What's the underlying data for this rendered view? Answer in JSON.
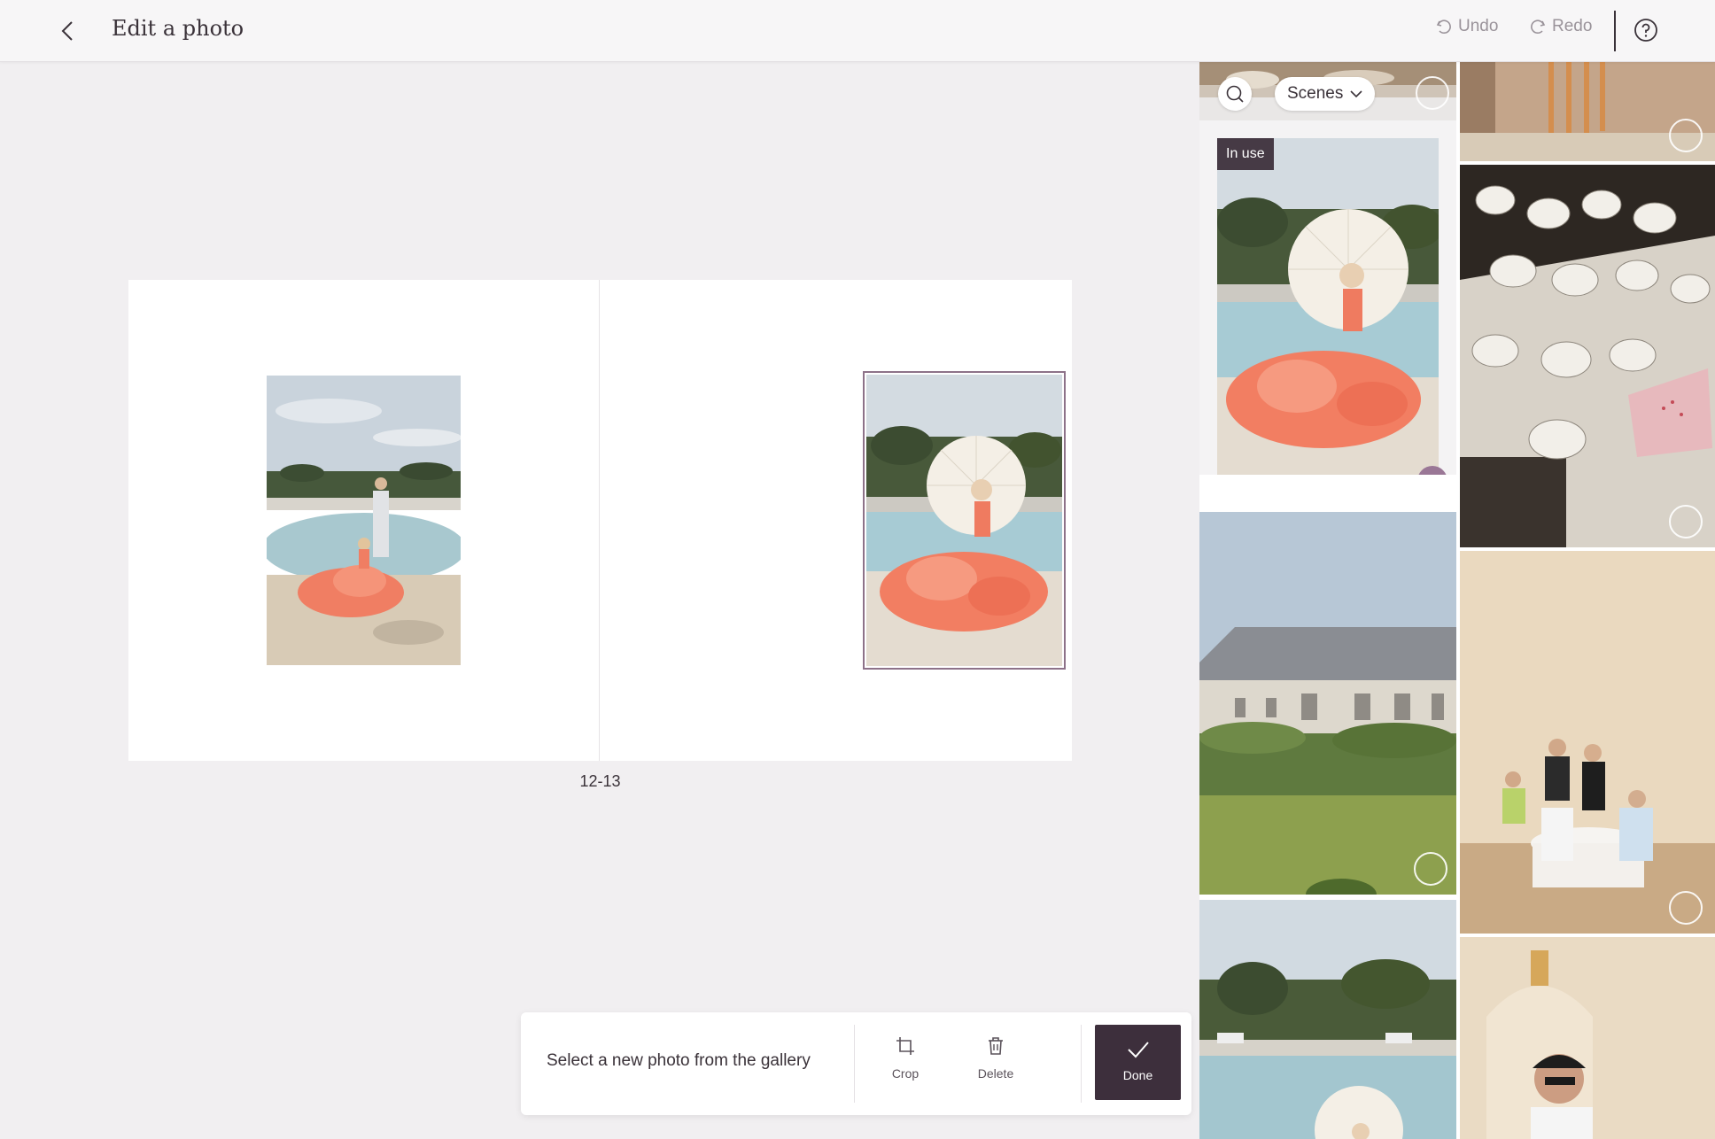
{
  "header": {
    "title": "Edit a photo",
    "undo_label": "Undo",
    "redo_label": "Redo",
    "back_icon": "chevron-left-icon",
    "help_icon": "help-circle-icon"
  },
  "spread": {
    "page_number": "12-13",
    "left_photo": "pool-couple-photo",
    "right_photo": "parasol-woman-photo"
  },
  "toolbar": {
    "message": "Select a new photo from the gallery",
    "crop_label": "Crop",
    "delete_label": "Delete",
    "done_label": "Done"
  },
  "gallery": {
    "search_icon": "search-icon",
    "filter_label": "Scenes",
    "in_use_label": "In use",
    "tiles": [
      {
        "name": "buffet-table-photo",
        "state": "unselected"
      },
      {
        "name": "candles-photo",
        "state": "unselected"
      },
      {
        "name": "parasol-woman-photo",
        "state": "selected",
        "in_use": true
      },
      {
        "name": "teacups-photo",
        "state": "unselected"
      },
      {
        "name": "chateau-photo",
        "state": "unselected"
      },
      {
        "name": "dinner-party-photo",
        "state": "unselected"
      },
      {
        "name": "pool-parasol-photo",
        "state": "unselected"
      },
      {
        "name": "man-sunglasses-photo",
        "state": "unselected"
      }
    ]
  },
  "colors": {
    "accent": "#9a7796",
    "done_button": "#3d2f3c",
    "selection_border": "#8d7289",
    "background": "#f1eff1"
  }
}
